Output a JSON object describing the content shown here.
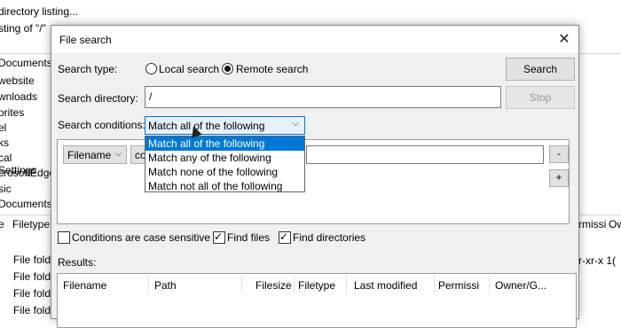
{
  "background": {
    "log_lines": [
      "directory listing...",
      "sting of \"/\""
    ],
    "tree_path": "Documents\\",
    "tree_items": [
      "website",
      "wnloads",
      "orites",
      "el",
      "ks",
      "cal Settings",
      "crosoftEdge",
      "sic",
      "Documents"
    ],
    "list_headers": [
      "e",
      "Filetype",
      "rmissi",
      "Ow"
    ],
    "list_rows": [
      "File fold",
      "File fold",
      "File fold",
      "File fold",
      "File fold"
    ],
    "right_text": "r-xr-x  1("
  },
  "dialog": {
    "title": "File search",
    "search_type_label": "Search type:",
    "local_search_label": "Local search",
    "remote_search_label": "Remote search",
    "selected_search_type": "remote",
    "search_button": "Search",
    "search_directory_label": "Search directory:",
    "search_directory_value": "/",
    "stop_button": "Stop",
    "search_conditions_label": "Search conditions:",
    "conditions_selected": "Match all of the following",
    "conditions_options": [
      "Match all of the following",
      "Match any of the following",
      "Match none of the following",
      "Match not all of the following"
    ],
    "condition_row": {
      "field": "Filename",
      "operator_partial": "co",
      "value": ""
    },
    "remove_button": "-",
    "add_button": "+",
    "case_sensitive_label": "Conditions are case sensitive",
    "case_sensitive_checked": false,
    "find_files_label": "Find files",
    "find_files_checked": true,
    "find_dirs_label": "Find directories",
    "find_dirs_checked": true,
    "results_label": "Results:",
    "results_columns": [
      "Filename",
      "Path",
      "Filesize",
      "Filetype",
      "Last modified",
      "Permissi",
      "Owner/G..."
    ]
  }
}
